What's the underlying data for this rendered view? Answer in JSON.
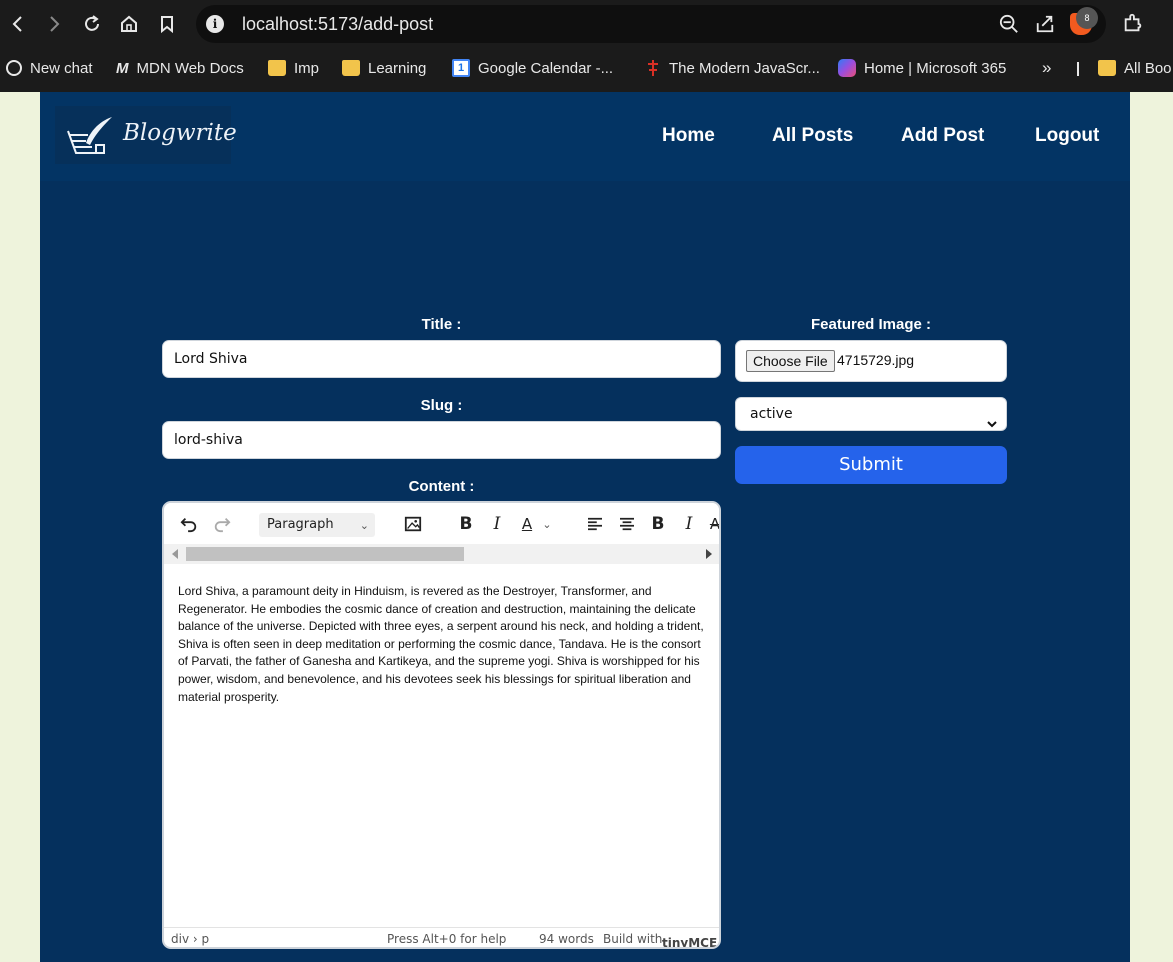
{
  "browser": {
    "url": "localhost:5173/add-post",
    "profile_badge": "8",
    "bookmarks": [
      {
        "label": "New chat",
        "icon": "openai-icon"
      },
      {
        "label": "MDN Web Docs",
        "icon": "mdn-icon"
      },
      {
        "label": "Imp",
        "icon": "folder-icon"
      },
      {
        "label": "Learning",
        "icon": "folder-icon"
      },
      {
        "label": "Google Calendar -...",
        "icon": "calendar-icon"
      },
      {
        "label": "The Modern JavaScr...",
        "icon": "js-icon"
      },
      {
        "label": "Home | Microsoft 365",
        "icon": "m365-icon"
      },
      {
        "label": "All Boo",
        "icon": "folder-icon"
      }
    ],
    "overflow_label": "»"
  },
  "header": {
    "logo_text": "Blogwrite",
    "nav": [
      "Home",
      "All Posts",
      "Add Post",
      "Logout"
    ]
  },
  "form": {
    "title_label": "Title :",
    "title_value": "Lord Shiva",
    "slug_label": "Slug :",
    "slug_value": "lord-shiva",
    "content_label": "Content :",
    "featured_label": "Featured Image :",
    "choose_file_label": "Choose File",
    "file_name": "4715729.jpg",
    "status_value": "active",
    "submit_label": "Submit"
  },
  "editor": {
    "block_format": "Paragraph",
    "text": "Lord Shiva, a paramount deity in Hinduism, is revered as the Destroyer, Transformer, and Regenerator. He embodies the cosmic dance of creation and destruction, maintaining the delicate balance of the universe. Depicted with three eyes, a serpent around his neck, and holding a trident, Shiva is often seen in deep meditation or performing the cosmic dance, Tandava. He is the consort of Parvati, the father of Ganesha and Kartikeya, and the supreme yogi. Shiva is worshipped for his power, wisdom, and benevolence, and his devotees seek his blessings for spiritual liberation and material prosperity.",
    "path": "div › p",
    "help": "Press Alt+0 for help",
    "word_count": "94 words",
    "build_with": "Build with",
    "brand": "tinyMCE"
  },
  "colors": {
    "page_bg": "#05305d",
    "header_bg": "#033464",
    "submit_bg": "#2563eb",
    "chrome_bg": "#1b1b1b"
  }
}
